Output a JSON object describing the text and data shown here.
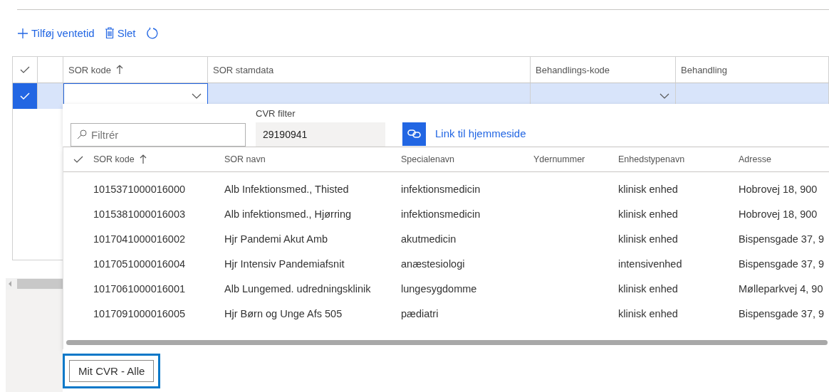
{
  "toolbar": [
    {
      "kind": "add",
      "label": "Tilføj ventetid"
    },
    {
      "kind": "delete",
      "label": "Slet"
    },
    {
      "kind": "refresh"
    }
  ],
  "grid": {
    "columns": [
      {
        "label": "SOR kode",
        "sorted": true
      },
      {
        "label": "SOR stamdata",
        "sorted": false
      },
      {
        "label": "Behandlings-kode",
        "sorted": false
      },
      {
        "label": "Behandling",
        "sorted": false
      }
    ],
    "rows": [
      {
        "selected": true
      }
    ]
  },
  "lookup": {
    "filter": {
      "placeholder": "Filtrér"
    },
    "cvr_filter": {
      "label": "CVR filter",
      "value": "29190941"
    },
    "link": "Link til hjemmeside",
    "columns": [
      {
        "label": "SOR kode",
        "sorted": true
      },
      {
        "label": "SOR navn",
        "sorted": false
      },
      {
        "label": "Specialenavn",
        "sorted": false
      },
      {
        "label": "Ydernummer",
        "sorted": false
      },
      {
        "label": "Enhedstypenavn",
        "sorted": false
      },
      {
        "label": "Adresse",
        "sorted": false
      }
    ],
    "rows": [
      [
        "1015371000016000",
        "Alb Infektionsmed., Thisted",
        "infektionsmedicin",
        "",
        "klinisk enhed",
        "Hobrovej 18, 900"
      ],
      [
        "1015381000016003",
        "Alb infektionsmed., Hjørring",
        "infektionsmedicin",
        "",
        "klinisk enhed",
        "Hobrovej 18, 900"
      ],
      [
        "1017041000016002",
        "Hjr Pandemi Akut Amb",
        "akutmedicin",
        "",
        "klinisk enhed",
        "Bispensgade 37, 9"
      ],
      [
        "1017051000016004",
        "Hjr Intensiv Pandemiafsnit",
        "anæstesiologi",
        "",
        "intensivenhed",
        "Bispensgade 37, 9"
      ],
      [
        "1017061000016001",
        "Alb Lungemed. udredningsklinik",
        "lungesygdomme",
        "",
        "klinisk enhed",
        "Mølleparkvej 4, 90"
      ],
      [
        "1017091000016005",
        "Hjr Børn og Unge Afs 505",
        "pædiatri",
        "",
        "klinisk enhed",
        "Bispensgade 37, 9"
      ]
    ],
    "button": "Mit CVR - Alle"
  }
}
